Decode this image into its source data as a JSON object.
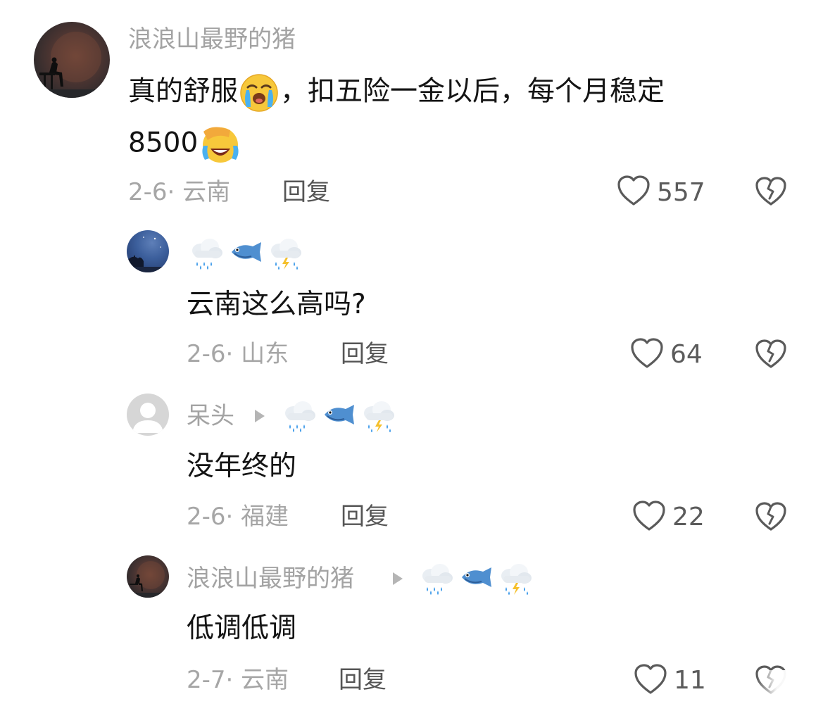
{
  "comments": [
    {
      "username": "浪浪山最野的猪",
      "text_part1": "真的舒服",
      "text_part2": "，扣五险一金以后，每个月稳定",
      "text_line2": "8500",
      "date_location": "2-6· 云南",
      "reply_label": "回复",
      "like_count": "557"
    },
    {
      "text": "云南这么高吗?",
      "date_location": "2-6· 山东",
      "reply_label": "回复",
      "like_count": "64"
    },
    {
      "username": "呆头",
      "text": "没年终的",
      "date_location": "2-6· 福建",
      "reply_label": "回复",
      "like_count": "22"
    },
    {
      "username": "浪浪山最野的猪",
      "text": "低调低调",
      "date_location": "2-7· 云南",
      "reply_label": "回复",
      "like_count": "11"
    }
  ],
  "icons": {
    "like": "heart-outline-icon",
    "dislike": "broken-heart-icon",
    "reply_arrow": "play-triangle-icon",
    "rain_cloud": "cloud-rain-emoji",
    "fish": "fish-emoji",
    "storm_cloud": "cloud-lightning-rain-emoji",
    "crying_face": "loudly-crying-face-emoji",
    "facepalm": "face-with-hand-over-eyes-emoji"
  },
  "colors": {
    "username": "#a3a3a3",
    "meta": "#a6a6a6",
    "text": "#141414",
    "reply": "#555555",
    "icon_stroke": "#5a5a5a"
  }
}
